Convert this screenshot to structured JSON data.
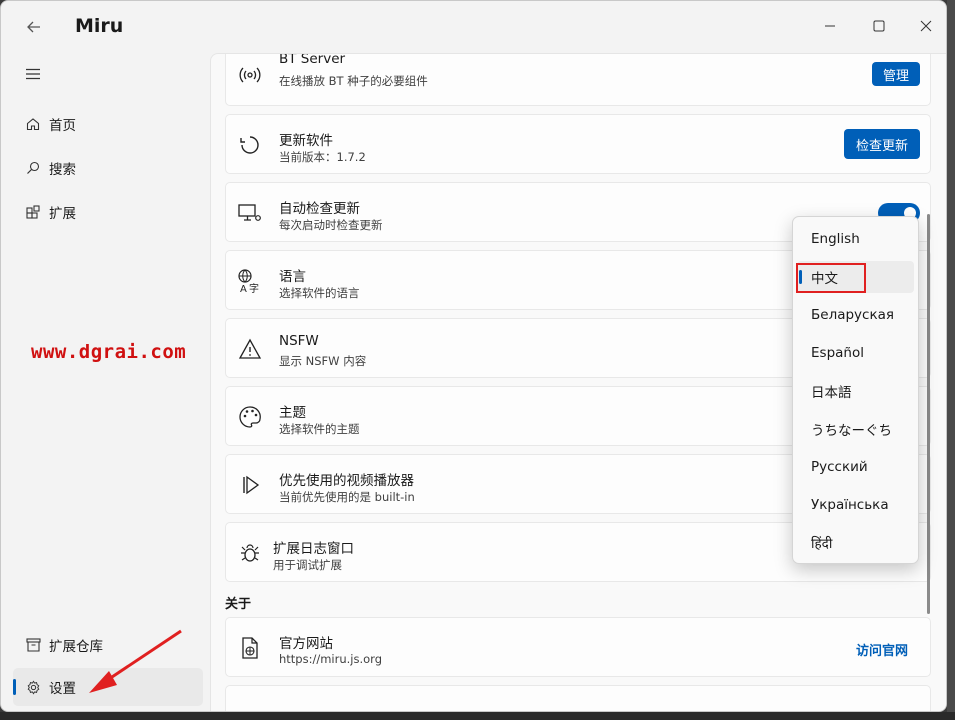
{
  "app": {
    "title": "Miru"
  },
  "sidebar": {
    "items": [
      {
        "label": "首页",
        "icon": "home-icon"
      },
      {
        "label": "搜索",
        "icon": "search-icon"
      },
      {
        "label": "扩展",
        "icon": "extensions-icon"
      }
    ],
    "bottom_items": [
      {
        "label": "扩展仓库",
        "icon": "repository-icon"
      },
      {
        "label": "设置",
        "icon": "gear-icon",
        "selected": true
      }
    ]
  },
  "watermark": "www.dgrai.com",
  "settings": {
    "bt_server": {
      "title": "BT Server",
      "subtitle": "在线播放 BT 种子的必要组件",
      "button": "管理"
    },
    "update": {
      "title": "更新软件",
      "subtitle": "当前版本：1.7.2",
      "button": "检查更新"
    },
    "auto_update": {
      "title": "自动检查更新",
      "subtitle": "每次启动时检查更新",
      "enabled": true
    },
    "language": {
      "title": "语言",
      "subtitle": "选择软件的语言"
    },
    "nsfw": {
      "title": "NSFW",
      "subtitle": "显示 NSFW 内容"
    },
    "theme": {
      "title": "主题",
      "subtitle": "选择软件的主题"
    },
    "player": {
      "title": "优先使用的视频播放器",
      "subtitle": "当前优先使用的是 built-in"
    },
    "ext_log": {
      "title": "扩展日志窗口",
      "subtitle": "用于调试扩展"
    }
  },
  "about": {
    "label": "关于",
    "website": {
      "title": "官方网站",
      "subtitle": "https://miru.js.org",
      "link": "访问官网"
    }
  },
  "language_dropdown": {
    "options": [
      "English",
      "中文",
      "Беларуская",
      "Español",
      "日本語",
      "うちなーぐち",
      "Русский",
      "Українська",
      "हिंदी"
    ],
    "selected": "中文"
  },
  "colors": {
    "accent": "#005fb8",
    "highlight": "#e02020",
    "watermark": "#d01010"
  }
}
